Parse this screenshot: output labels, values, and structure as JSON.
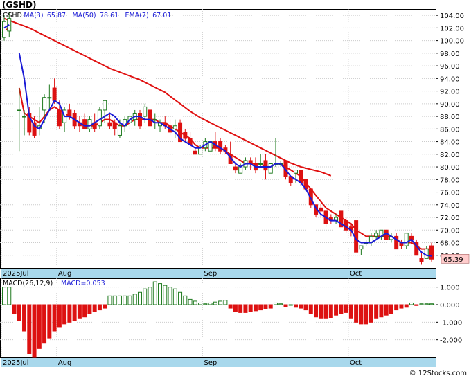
{
  "header": {
    "title": "(GSHD)"
  },
  "footer": {
    "credit": "© 12Stocks.com"
  },
  "legend_price": {
    "ticker": "GSHD",
    "ma3": "MA(3)",
    "ma3_val": "65.87",
    "ma50": "MA(50)",
    "ma50_val": "78.61",
    "ema7": "EMA(7)",
    "ema7_val": "67.01"
  },
  "legend_macd": {
    "label": "MACD(26,12,9)",
    "value": "MACD=0.053"
  },
  "price_badge": "65.39",
  "colors": {
    "up": "#1f7a1f",
    "down": "#dd1111",
    "ma3": "#1a1ad6",
    "ema": "#e01010",
    "ma50": "#e01010",
    "axisbar": "#a8d8ec",
    "badge": "#ffcccc"
  },
  "chart_data": [
    {
      "type": "candlestick",
      "title": "",
      "ylim": [
        64,
        105
      ],
      "yticks": [
        66,
        68,
        70,
        72,
        74,
        76,
        78,
        80,
        82,
        84,
        86,
        88,
        90,
        92,
        94,
        96,
        98,
        100,
        102,
        104
      ],
      "ytick_labels": [
        "66.00",
        "68.00",
        "70.00",
        "72.00",
        "74.00",
        "76.00",
        "78.00",
        "80.00",
        "82.00",
        "84.00",
        "86.00",
        "88.00",
        "90.00",
        "92.00",
        "94.00",
        "96.00",
        "98.00",
        "100.00",
        "102.00",
        "104.00"
      ],
      "xtick_labels": [
        "2025Jul",
        "Aug",
        "Sep",
        "Oct"
      ],
      "xtick_index": [
        0,
        11,
        40,
        69
      ],
      "candles": [
        [
          100.5,
          104.0,
          100.0,
          103.0
        ],
        [
          101.5,
          104.5,
          100.5,
          103.5
        ],
        [
          null,
          null,
          null,
          null
        ],
        [
          89.0,
          92.5,
          82.5,
          89.0
        ],
        [
          88.0,
          89.0,
          85.0,
          88.0
        ],
        [
          88.5,
          89.5,
          85.0,
          85.5
        ],
        [
          87.0,
          88.0,
          84.5,
          85.0
        ],
        [
          86.0,
          89.5,
          85.0,
          86.5
        ],
        [
          89.0,
          91.5,
          87.0,
          91.0
        ],
        [
          91.0,
          93.0,
          89.0,
          91.0
        ],
        [
          92.5,
          94.0,
          90.0,
          90.5
        ],
        [
          89.0,
          90.5,
          86.0,
          86.5
        ],
        [
          87.0,
          89.5,
          85.5,
          89.0
        ],
        [
          89.0,
          90.0,
          87.5,
          88.0
        ],
        [
          88.5,
          89.0,
          86.0,
          86.5
        ],
        [
          87.0,
          88.0,
          85.5,
          86.5
        ],
        [
          87.5,
          88.5,
          86.0,
          86.0
        ],
        [
          86.0,
          88.0,
          85.5,
          87.5
        ],
        [
          87.0,
          88.5,
          85.5,
          86.0
        ],
        [
          86.5,
          89.5,
          86.0,
          89.0
        ],
        [
          89.0,
          90.5,
          87.0,
          90.5
        ],
        [
          87.0,
          88.5,
          86.0,
          86.5
        ],
        [
          87.0,
          87.5,
          85.0,
          86.0
        ],
        [
          85.0,
          87.5,
          84.5,
          86.5
        ],
        [
          86.5,
          88.0,
          85.5,
          87.5
        ],
        [
          87.0,
          88.5,
          86.0,
          88.0
        ],
        [
          87.5,
          89.0,
          86.5,
          88.5
        ],
        [
          88.5,
          89.0,
          86.0,
          86.5
        ],
        [
          88.0,
          90.0,
          87.0,
          89.5
        ],
        [
          89.0,
          89.5,
          86.0,
          86.5
        ],
        [
          87.5,
          88.5,
          86.0,
          87.5
        ],
        [
          86.5,
          87.5,
          85.5,
          87.0
        ],
        [
          87.0,
          88.0,
          86.0,
          86.5
        ],
        [
          86.5,
          87.5,
          85.0,
          85.5
        ],
        [
          86.0,
          87.5,
          84.5,
          86.5
        ],
        [
          87.0,
          87.5,
          84.0,
          84.0
        ],
        [
          85.5,
          86.0,
          84.0,
          84.5
        ],
        [
          84.5,
          85.5,
          83.0,
          83.5
        ],
        [
          82.5,
          83.0,
          82.0,
          82.0
        ],
        [
          82.0,
          83.5,
          82.0,
          83.0
        ],
        [
          83.0,
          84.5,
          82.5,
          84.0
        ],
        [
          82.5,
          84.0,
          82.5,
          84.0
        ],
        [
          84.0,
          85.5,
          82.5,
          83.0
        ],
        [
          84.0,
          84.5,
          82.0,
          82.5
        ],
        [
          83.0,
          83.5,
          82.0,
          82.5
        ],
        [
          82.0,
          84.0,
          80.5,
          80.5
        ],
        [
          80.0,
          80.5,
          79.0,
          79.5
        ],
        [
          79.0,
          80.5,
          79.5,
          80.0
        ],
        [
          80.0,
          81.5,
          79.5,
          81.0
        ],
        [
          81.0,
          81.5,
          79.5,
          80.5
        ],
        [
          80.5,
          81.5,
          79.0,
          79.5
        ],
        [
          80.5,
          82.0,
          80.0,
          80.5
        ],
        [
          81.0,
          82.0,
          78.0,
          79.5
        ],
        [
          79.0,
          80.5,
          79.5,
          80.5
        ],
        [
          80.5,
          84.5,
          80.0,
          80.5
        ],
        [
          80.5,
          81.0,
          80.0,
          80.5
        ],
        [
          81.0,
          81.0,
          78.0,
          78.5
        ],
        [
          78.5,
          78.5,
          77.0,
          77.5
        ],
        [
          79.0,
          79.5,
          77.5,
          79.5
        ],
        [
          79.5,
          79.5,
          77.0,
          77.5
        ],
        [
          78.0,
          78.0,
          76.5,
          76.5
        ],
        [
          76.5,
          76.5,
          73.5,
          74.0
        ],
        [
          74.0,
          74.0,
          72.0,
          72.5
        ],
        [
          73.5,
          74.0,
          72.0,
          73.0
        ],
        [
          73.0,
          73.5,
          70.5,
          71.0
        ],
        [
          72.0,
          72.5,
          71.0,
          71.5
        ],
        [
          71.5,
          72.5,
          71.0,
          72.0
        ],
        [
          73.0,
          73.0,
          70.5,
          70.5
        ],
        [
          71.5,
          72.0,
          69.5,
          70.0
        ],
        [
          70.5,
          71.0,
          69.0,
          70.0
        ],
        [
          71.5,
          71.5,
          66.5,
          66.5
        ],
        [
          67.0,
          67.5,
          66.0,
          67.5
        ],
        [
          68.0,
          68.5,
          67.5,
          68.0
        ],
        [
          68.0,
          69.5,
          67.5,
          69.0
        ],
        [
          69.0,
          70.0,
          68.5,
          69.5
        ],
        [
          69.0,
          70.0,
          68.5,
          70.0
        ],
        [
          70.0,
          70.0,
          68.5,
          68.5
        ],
        [
          68.5,
          69.5,
          68.0,
          69.0
        ],
        [
          69.0,
          69.5,
          67.0,
          67.0
        ],
        [
          68.0,
          68.5,
          67.0,
          67.5
        ],
        [
          67.5,
          69.5,
          67.0,
          69.5
        ],
        [
          69.0,
          69.5,
          68.0,
          68.5
        ],
        [
          68.0,
          68.5,
          66.0,
          66.0
        ],
        [
          65.5,
          66.5,
          64.5,
          65.0
        ],
        [
          65.5,
          67.5,
          65.5,
          67.0
        ],
        [
          67.5,
          68.0,
          65.0,
          65.4
        ]
      ],
      "ma3": [
        102.0,
        102.5,
        null,
        98.0,
        94.0,
        88.0,
        86.5,
        86.0,
        87.5,
        89.0,
        90.5,
        90.0,
        88.0,
        88.0,
        87.5,
        87.0,
        86.5,
        86.5,
        87.0,
        87.5,
        88.0,
        88.5,
        88.0,
        87.0,
        86.5,
        87.5,
        88.0,
        88.0,
        87.5,
        87.5,
        87.0,
        87.0,
        86.5,
        86.0,
        85.5,
        84.5,
        84.0,
        83.5,
        83.0,
        83.0,
        83.5,
        84.0,
        83.5,
        83.0,
        82.5,
        81.5,
        80.5,
        80.0,
        80.5,
        80.5,
        80.0,
        80.0,
        80.0,
        80.0,
        80.5,
        80.5,
        79.5,
        78.5,
        78.0,
        77.5,
        76.5,
        75.0,
        73.5,
        72.5,
        72.0,
        71.5,
        71.5,
        71.0,
        70.5,
        70.0,
        68.5,
        68.0,
        68.0,
        68.0,
        68.5,
        69.0,
        69.5,
        69.0,
        68.5,
        68.0,
        68.0,
        68.5,
        67.5,
        66.5,
        66.0,
        65.9
      ],
      "ema7": [
        101.5,
        102.0,
        null,
        92.5,
        88.5,
        88.0,
        87.5,
        87.0,
        88.0,
        89.0,
        89.5,
        89.0,
        88.5,
        88.0,
        87.5,
        87.0,
        86.5,
        86.5,
        86.5,
        87.0,
        87.5,
        87.5,
        87.0,
        86.5,
        86.5,
        87.0,
        87.5,
        87.5,
        87.5,
        87.5,
        87.5,
        87.0,
        87.0,
        86.5,
        86.0,
        85.5,
        85.0,
        84.5,
        83.5,
        83.0,
        83.0,
        83.0,
        83.0,
        83.0,
        82.5,
        82.0,
        81.5,
        81.0,
        80.5,
        80.5,
        80.5,
        80.5,
        80.0,
        80.0,
        80.5,
        80.5,
        80.0,
        79.5,
        79.0,
        78.5,
        77.5,
        76.5,
        75.5,
        74.5,
        73.5,
        73.0,
        72.5,
        72.0,
        71.5,
        71.0,
        70.0,
        69.5,
        69.0,
        69.0,
        69.0,
        69.0,
        69.0,
        69.0,
        68.5,
        68.0,
        68.0,
        68.0,
        67.5,
        67.0,
        67.0,
        67.0
      ],
      "ma50": [
        103.5,
        103.2,
        102.9,
        102.6,
        102.3,
        102.0,
        101.6,
        101.2,
        100.8,
        100.4,
        100.0,
        99.6,
        99.2,
        98.8,
        98.4,
        98.0,
        97.6,
        97.2,
        96.8,
        96.4,
        96.0,
        95.6,
        95.3,
        95.0,
        94.7,
        94.4,
        94.1,
        93.8,
        93.4,
        93.0,
        92.6,
        92.2,
        91.8,
        91.2,
        90.6,
        90.0,
        89.4,
        88.8,
        88.3,
        87.8,
        87.4,
        87.0,
        86.6,
        86.2,
        85.8,
        85.4,
        85.0,
        84.6,
        84.2,
        83.8,
        83.4,
        83.0,
        82.6,
        82.2,
        81.8,
        81.4,
        81.0,
        80.6,
        80.3,
        80.0,
        79.8,
        79.6,
        79.4,
        79.2,
        78.9,
        78.6
      ]
    },
    {
      "type": "bar",
      "title": "MACD(26,12,9)",
      "ylim": [
        -3,
        1.5
      ],
      "yticks": [
        1,
        0,
        -1,
        -2
      ],
      "ytick_labels": [
        "1.000",
        "0.000",
        "-1.000",
        "-2.000"
      ],
      "xtick_labels": [
        "2025Jul",
        "Aug",
        "Sep",
        "Oct"
      ],
      "values": [
        1.0,
        1.0,
        -0.5,
        -0.9,
        -1.5,
        -2.8,
        -3.0,
        -2.5,
        -2.2,
        -1.9,
        -1.5,
        -1.3,
        -1.1,
        -1.0,
        -0.9,
        -0.8,
        -0.7,
        -0.5,
        -0.4,
        -0.3,
        -0.2,
        0.5,
        0.5,
        0.5,
        0.5,
        0.5,
        0.6,
        0.7,
        0.9,
        1.0,
        1.3,
        1.2,
        1.1,
        1.0,
        0.9,
        0.7,
        0.5,
        0.3,
        0.2,
        0.1,
        0.05,
        0.1,
        0.15,
        0.2,
        0.25,
        -0.2,
        -0.4,
        -0.45,
        -0.45,
        -0.4,
        -0.35,
        -0.3,
        -0.25,
        -0.2,
        0.1,
        0.05,
        -0.1,
        0.0,
        -0.15,
        -0.2,
        -0.3,
        -0.5,
        -0.7,
        -0.8,
        -0.8,
        -0.75,
        -0.6,
        -0.5,
        -0.45,
        -0.8,
        -1.0,
        -1.1,
        -1.1,
        -1.0,
        -0.8,
        -0.7,
        -0.6,
        -0.5,
        -0.3,
        -0.2,
        -0.15,
        0.1,
        -0.05,
        0.05,
        0.05,
        0.05
      ]
    }
  ]
}
